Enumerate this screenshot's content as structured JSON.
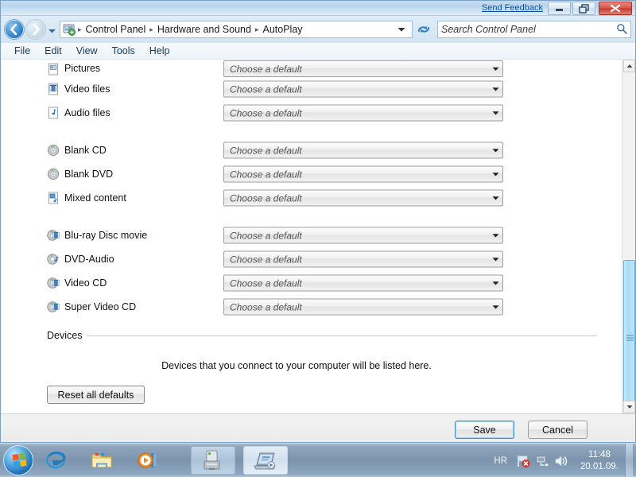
{
  "titlebar": {
    "feedback_label": "Send Feedback",
    "minimize_icon": "minimize-icon",
    "maximize_icon": "restore-icon",
    "close_icon": "close-icon"
  },
  "addressbar": {
    "back_icon": "back-arrow-icon",
    "forward_icon": "forward-arrow-icon",
    "history_icon": "chevron-down-icon",
    "location_icon": "control-panel-icon",
    "crumbs": [
      "Control Panel",
      "Hardware and Sound",
      "AutoPlay"
    ],
    "separator": "▸",
    "dropdown_icon": "chevron-down-icon",
    "refresh_icon": "refresh-icon"
  },
  "search": {
    "placeholder": "Search Control Panel",
    "icon": "search-icon"
  },
  "menubar": {
    "items": [
      "File",
      "Edit",
      "View",
      "Tools",
      "Help"
    ]
  },
  "main": {
    "combo_placeholder": "Choose a default",
    "combo_arrow_icon": "chevron-down-icon",
    "groups": [
      {
        "items": [
          {
            "label": "Pictures",
            "icon": "pictures-file-icon",
            "value": "Choose a default"
          },
          {
            "label": "Video files",
            "icon": "video-file-icon",
            "value": "Choose a default"
          },
          {
            "label": "Audio files",
            "icon": "audio-file-icon",
            "value": "Choose a default"
          }
        ]
      },
      {
        "items": [
          {
            "label": "Blank CD",
            "icon": "blank-disc-icon",
            "value": "Choose a default"
          },
          {
            "label": "Blank DVD",
            "icon": "blank-disc-icon",
            "value": "Choose a default"
          },
          {
            "label": "Mixed content",
            "icon": "mixed-content-icon",
            "value": "Choose a default"
          }
        ]
      },
      {
        "items": [
          {
            "label": "Blu-ray Disc movie",
            "icon": "video-disc-icon",
            "value": "Choose a default"
          },
          {
            "label": "DVD-Audio",
            "icon": "audio-disc-icon",
            "value": "Choose a default"
          },
          {
            "label": "Video CD",
            "icon": "video-disc-icon",
            "value": "Choose a default"
          },
          {
            "label": "Super Video CD",
            "icon": "video-disc-icon",
            "value": "Choose a default"
          }
        ]
      }
    ],
    "devices": {
      "title": "Devices",
      "empty_message": "Devices that you connect to your computer will be listed here.",
      "reset_label": "Reset all defaults"
    }
  },
  "commandbar": {
    "save_label": "Save",
    "cancel_label": "Cancel"
  },
  "scrollbar": {
    "up_icon": "scroll-up-icon",
    "down_icon": "scroll-down-icon"
  },
  "taskbar": {
    "start_icon": "windows-start-orb-icon",
    "quick_launch": [
      {
        "name": "internet-explorer-icon"
      },
      {
        "name": "windows-explorer-icon"
      },
      {
        "name": "media-player-icon"
      }
    ],
    "tasks": [
      {
        "name": "system-window-icon"
      },
      {
        "name": "autoplay-window-icon"
      }
    ],
    "tray": {
      "language": "HR",
      "icons": [
        "action-center-flag-error-icon",
        "network-icon",
        "volume-icon"
      ],
      "time": "11:48",
      "date": "20.01.09."
    }
  }
}
